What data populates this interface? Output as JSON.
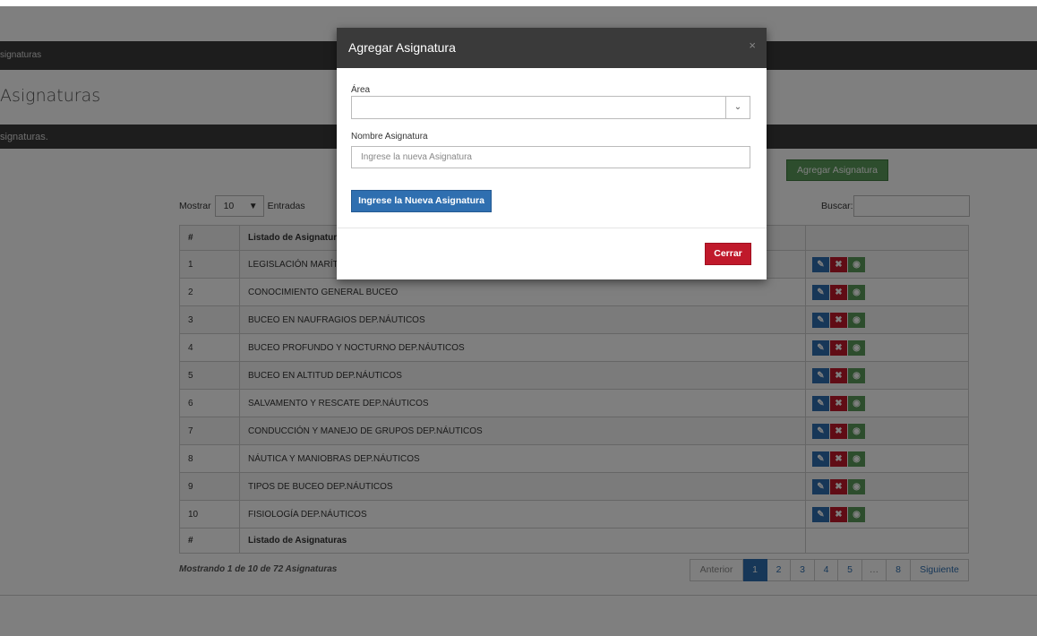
{
  "breadcrumb": "signaturas",
  "page_title": "Asignaturas",
  "section_bar": "signaturas.",
  "add_button": "Agregar Asignatura",
  "length": {
    "show_label": "Mostrar",
    "value": "10",
    "entries_label": "Entradas"
  },
  "search": {
    "label": "Buscar:"
  },
  "table": {
    "headers": [
      "#",
      "Listado de Asignaturas",
      ""
    ],
    "rows": [
      {
        "n": "1",
        "name": "LEGISLACIÓN MARÍTIMA"
      },
      {
        "n": "2",
        "name": "CONOCIMIENTO GENERAL BUCEO"
      },
      {
        "n": "3",
        "name": "BUCEO EN NAUFRAGIOS DEP.NÁUTICOS"
      },
      {
        "n": "4",
        "name": "BUCEO PROFUNDO Y NOCTURNO DEP.NÁUTICOS"
      },
      {
        "n": "5",
        "name": "BUCEO EN ALTITUD DEP.NÁUTICOS"
      },
      {
        "n": "6",
        "name": "SALVAMENTO Y RESCATE DEP.NÁUTICOS"
      },
      {
        "n": "7",
        "name": "CONDUCCIÓN Y MANEJO DE GRUPOS DEP.NÁUTICOS"
      },
      {
        "n": "8",
        "name": "NÁUTICA Y MANIOBRAS DEP.NÁUTICOS"
      },
      {
        "n": "9",
        "name": "TIPOS DE BUCEO DEP.NÁUTICOS"
      },
      {
        "n": "10",
        "name": "FISIOLOGÍA DEP.NÁUTICOS"
      }
    ],
    "footer": [
      "#",
      "Listado de Asignaturas",
      ""
    ]
  },
  "info": "Mostrando 1 de 10 de 72 Asignaturas",
  "pagination": {
    "prev": "Anterior",
    "pages": [
      "1",
      "2",
      "3",
      "4",
      "5",
      "…",
      "8"
    ],
    "current": "1",
    "next": "Siguiente"
  },
  "icons": {
    "edit": "pencil-icon",
    "delete": "x-icon",
    "view": "eye-icon",
    "close": "close-icon",
    "select_caret": "chevron-down-icon"
  },
  "colors": {
    "primary": "#2f6fb0",
    "danger": "#c0192b",
    "success": "#5a9a5a",
    "dark": "#3a3a3a"
  },
  "modal": {
    "title": "Agregar Asignatura",
    "close_glyph": "×",
    "area_label": "Área",
    "area_value": "",
    "name_label": "Nombre Asignatura",
    "name_placeholder": "Ingrese la nueva Asignatura",
    "submit_label": "Ingrese la Nueva Asignatura",
    "cancel_label": "Cerrar"
  }
}
